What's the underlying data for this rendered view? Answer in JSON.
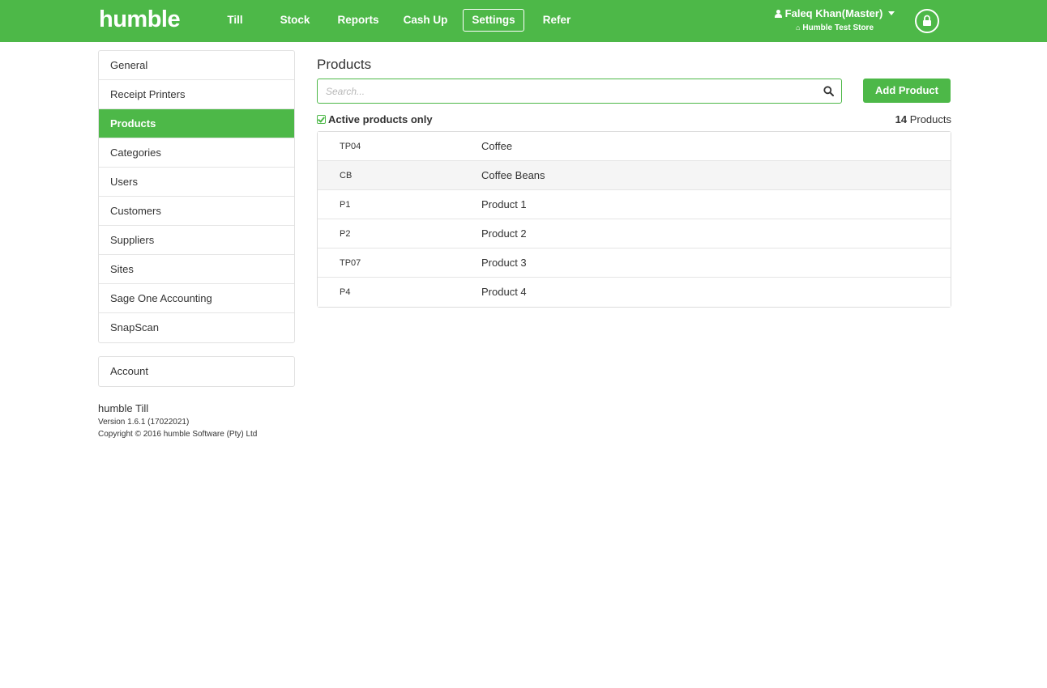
{
  "app": {
    "logo": "humble",
    "brand_color": "#4db848"
  },
  "nav": {
    "items": [
      {
        "label": "Till"
      },
      {
        "label": "Stock"
      },
      {
        "label": "Reports"
      },
      {
        "label": "Cash Up"
      },
      {
        "label": "Settings",
        "active": true
      },
      {
        "label": "Refer"
      }
    ],
    "user": "Faleq Khan(Master)",
    "store": "Humble Test Store",
    "icons": {
      "user": "user-icon",
      "store": "home-icon",
      "lock": "lock-icon",
      "dropdown": "caret-down-icon"
    }
  },
  "sidebar": {
    "items": [
      {
        "label": "General"
      },
      {
        "label": "Receipt Printers"
      },
      {
        "label": "Products",
        "active": true
      },
      {
        "label": "Categories"
      },
      {
        "label": "Users"
      },
      {
        "label": "Customers"
      },
      {
        "label": "Suppliers"
      },
      {
        "label": "Sites"
      },
      {
        "label": "Sage One Accounting"
      },
      {
        "label": "SnapScan"
      }
    ],
    "account": "Account",
    "app_name": "humble Till",
    "version": "Version 1.6.1 (17022021)",
    "copyright": "Copyright © 2016 humble Software (Pty) Ltd"
  },
  "main": {
    "title": "Products",
    "search_placeholder": "Search...",
    "add_button": "Add Product",
    "filter_label": "Active products only",
    "count_number": "14",
    "count_label": "Products",
    "products": [
      {
        "code": "TP04",
        "name": "Coffee"
      },
      {
        "code": "CB",
        "name": "Coffee Beans"
      },
      {
        "code": "P1",
        "name": "Product 1"
      },
      {
        "code": "P2",
        "name": "Product 2"
      },
      {
        "code": "TP07",
        "name": "Product 3"
      },
      {
        "code": "P4",
        "name": "Product 4"
      }
    ]
  }
}
